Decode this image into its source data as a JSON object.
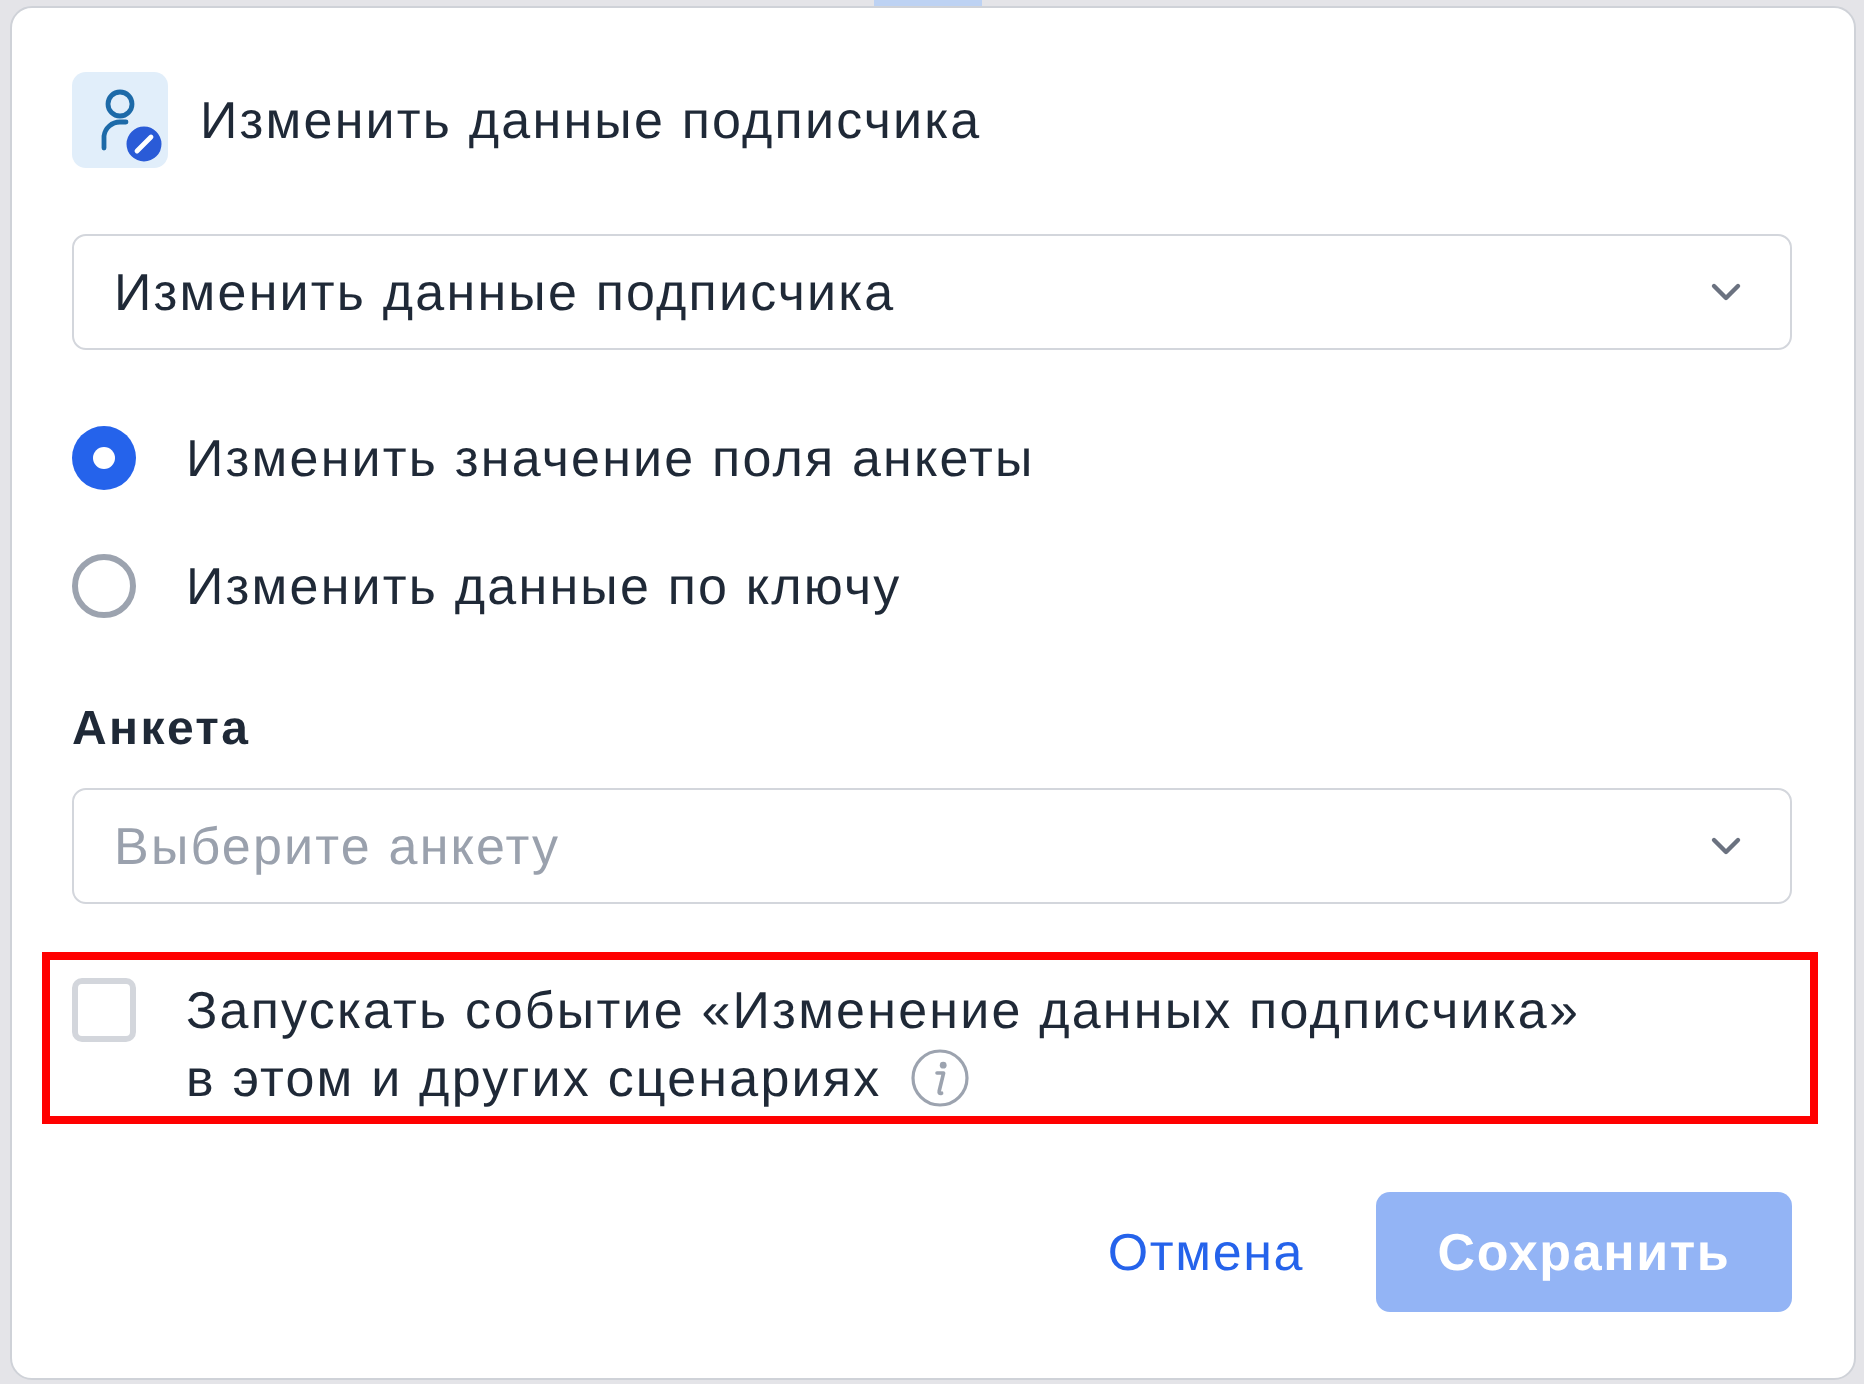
{
  "dialog": {
    "title": "Изменить данные подписчика"
  },
  "action_select": {
    "value": "Изменить данные подписчика"
  },
  "mode_options": [
    {
      "label": "Изменить значение поля анкеты",
      "selected": true
    },
    {
      "label": "Изменить данные по ключу",
      "selected": false
    }
  ],
  "form_field": {
    "label": "Анкета",
    "placeholder": "Выберите анкету"
  },
  "event_option": {
    "label": "Запускать событие «Изменение данных подписчика»\nв этом и других сценариях",
    "checked": false,
    "highlighted": true
  },
  "buttons": [
    {
      "label": "Отмена",
      "kind": "link",
      "disabled": false
    },
    {
      "label": "Сохранить",
      "kind": "primary",
      "disabled": true
    }
  ]
}
